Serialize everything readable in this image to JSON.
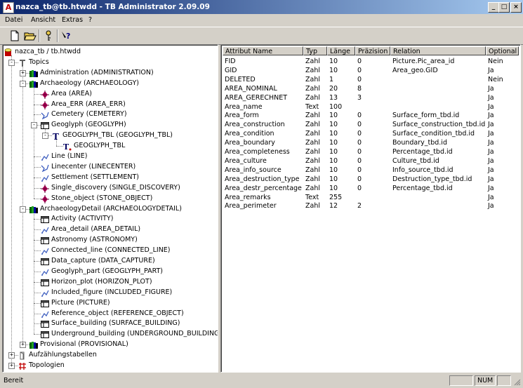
{
  "window": {
    "title": "nazca_tb@tb.htwdd - TB Administrator 2.09.09",
    "icon": "app-logo-icon",
    "buttons": {
      "minimize": "_",
      "maximize": "□",
      "close": "×"
    }
  },
  "menu": [
    "Datei",
    "Ansicht",
    "Extras",
    "?"
  ],
  "toolbar": [
    {
      "name": "new-file-icon"
    },
    {
      "name": "open-folder-icon"
    },
    {
      "name": "key-icon"
    },
    {
      "name": "help-icon"
    }
  ],
  "tree": [
    {
      "label": "nazca_tb / tb.htwdd",
      "level": 0,
      "icon": "database",
      "exp": ""
    },
    {
      "label": "Topics",
      "level": 1,
      "icon": "topics",
      "exp": "-"
    },
    {
      "label": "Administration (ADMINISTRATION)",
      "level": 2,
      "icon": "books",
      "exp": "+"
    },
    {
      "label": "Archaeology (ARCHAEOLOGY)",
      "level": 2,
      "icon": "books",
      "exp": "-"
    },
    {
      "label": "Area (AREA)",
      "level": 3,
      "icon": "area",
      "exp": ""
    },
    {
      "label": "Area_ERR (AREA_ERR)",
      "level": 3,
      "icon": "area",
      "exp": ""
    },
    {
      "label": "Cemetery (CEMETERY)",
      "level": 3,
      "icon": "polyline",
      "exp": ""
    },
    {
      "label": "Geoglyph (GEOGLYPH)",
      "level": 3,
      "icon": "table",
      "exp": "-"
    },
    {
      "label": "GEOGLYPH_TBL (GEOGLYPH_TBL)",
      "level": 4,
      "icon": "tblT",
      "exp": "-"
    },
    {
      "label": "GEOGLYPH_TBL",
      "level": 5,
      "icon": "tblTsub",
      "exp": ""
    },
    {
      "label": "Line (LINE)",
      "level": 3,
      "icon": "line",
      "exp": ""
    },
    {
      "label": "Linecenter (LINECENTER)",
      "level": 3,
      "icon": "polyline",
      "exp": ""
    },
    {
      "label": "Settlement (SETTLEMENT)",
      "level": 3,
      "icon": "line",
      "exp": ""
    },
    {
      "label": "Single_discovery (SINGLE_DISCOVERY)",
      "level": 3,
      "icon": "area",
      "exp": ""
    },
    {
      "label": "Stone_object (STONE_OBJECT)",
      "level": 3,
      "icon": "area",
      "exp": ""
    },
    {
      "label": "ArchaeologyDetail (ARCHAEOLOGYDETAIL)",
      "level": 2,
      "icon": "books",
      "exp": "-"
    },
    {
      "label": "Activity (ACTIVITY)",
      "level": 3,
      "icon": "table",
      "exp": ""
    },
    {
      "label": "Area_detail (AREA_DETAIL)",
      "level": 3,
      "icon": "line",
      "exp": ""
    },
    {
      "label": "Astronomy (ASTRONOMY)",
      "level": 3,
      "icon": "table",
      "exp": ""
    },
    {
      "label": "Connected_line (CONNECTED_LINE)",
      "level": 3,
      "icon": "line",
      "exp": ""
    },
    {
      "label": "Data_capture (DATA_CAPTURE)",
      "level": 3,
      "icon": "table",
      "exp": ""
    },
    {
      "label": "Geoglyph_part (GEOGLYPH_PART)",
      "level": 3,
      "icon": "line",
      "exp": ""
    },
    {
      "label": "Horizon_plot (HORIZON_PLOT)",
      "level": 3,
      "icon": "table",
      "exp": ""
    },
    {
      "label": "Included_figure (INCLUDED_FIGURE)",
      "level": 3,
      "icon": "line",
      "exp": ""
    },
    {
      "label": "Picture (PICTURE)",
      "level": 3,
      "icon": "table",
      "exp": ""
    },
    {
      "label": "Reference_object (REFERENCE_OBJECT)",
      "level": 3,
      "icon": "line",
      "exp": ""
    },
    {
      "label": "Surface_building (SURFACE_BUILDING)",
      "level": 3,
      "icon": "table",
      "exp": ""
    },
    {
      "label": "Underground_building (UNDERGROUND_BUILDING)",
      "level": 3,
      "icon": "table",
      "exp": ""
    },
    {
      "label": "Provisional (PROVISIONAL)",
      "level": 2,
      "icon": "books",
      "exp": "+"
    },
    {
      "label": "Aufzählungstabellen",
      "level": 1,
      "icon": "enum",
      "exp": "+"
    },
    {
      "label": "Topologien",
      "level": 1,
      "icon": "topology",
      "exp": "+"
    }
  ],
  "columns": [
    "Attribut Name",
    "Typ",
    "Länge",
    "Präzision",
    "Relation",
    "Optional"
  ],
  "rows": [
    [
      "FID",
      "Zahl",
      "10",
      "0",
      "Picture.Pic_area_id",
      "Nein"
    ],
    [
      "GID",
      "Zahl",
      "10",
      "0",
      "Area_geo.GID",
      "Ja"
    ],
    [
      "DELETED",
      "Zahl",
      "1",
      "0",
      "",
      "Nein"
    ],
    [
      "AREA_NOMINAL",
      "Zahl",
      "20",
      "8",
      "",
      "Ja"
    ],
    [
      "AREA_GERECHNET",
      "Zahl",
      "13",
      "3",
      "",
      "Ja"
    ],
    [
      "Area_name",
      "Text",
      "100",
      "",
      "",
      "Ja"
    ],
    [
      "Area_form",
      "Zahl",
      "10",
      "0",
      "Surface_form_tbd.id",
      "Ja"
    ],
    [
      "Area_construction",
      "Zahl",
      "10",
      "0",
      "Surface_construction_tbd.id",
      "Ja"
    ],
    [
      "Area_condition",
      "Zahl",
      "10",
      "0",
      "Surface_condition_tbd.id",
      "Ja"
    ],
    [
      "Area_boundary",
      "Zahl",
      "10",
      "0",
      "Boundary_tbd.id",
      "Ja"
    ],
    [
      "Area_completeness",
      "Zahl",
      "10",
      "0",
      "Percentage_tbd.id",
      "Ja"
    ],
    [
      "Area_culture",
      "Zahl",
      "10",
      "0",
      "Culture_tbd.id",
      "Ja"
    ],
    [
      "Area_info_source",
      "Zahl",
      "10",
      "0",
      "Info_source_tbd.id",
      "Ja"
    ],
    [
      "Area_destruction_type",
      "Zahl",
      "10",
      "0",
      "Destruction_type_tbd.id",
      "Ja"
    ],
    [
      "Area_destr_percentage",
      "Zahl",
      "10",
      "0",
      "Percentage_tbd.id",
      "Ja"
    ],
    [
      "Area_remarks",
      "Text",
      "255",
      "",
      "",
      "Ja"
    ],
    [
      "Area_perimeter",
      "Zahl",
      "12",
      "2",
      "",
      "Ja"
    ]
  ],
  "status": {
    "text": "Bereit",
    "num": "NUM"
  },
  "colors": {
    "titlebar_start": "#0a246a",
    "titlebar_end": "#a6caf0",
    "face": "#d4d0c8"
  }
}
